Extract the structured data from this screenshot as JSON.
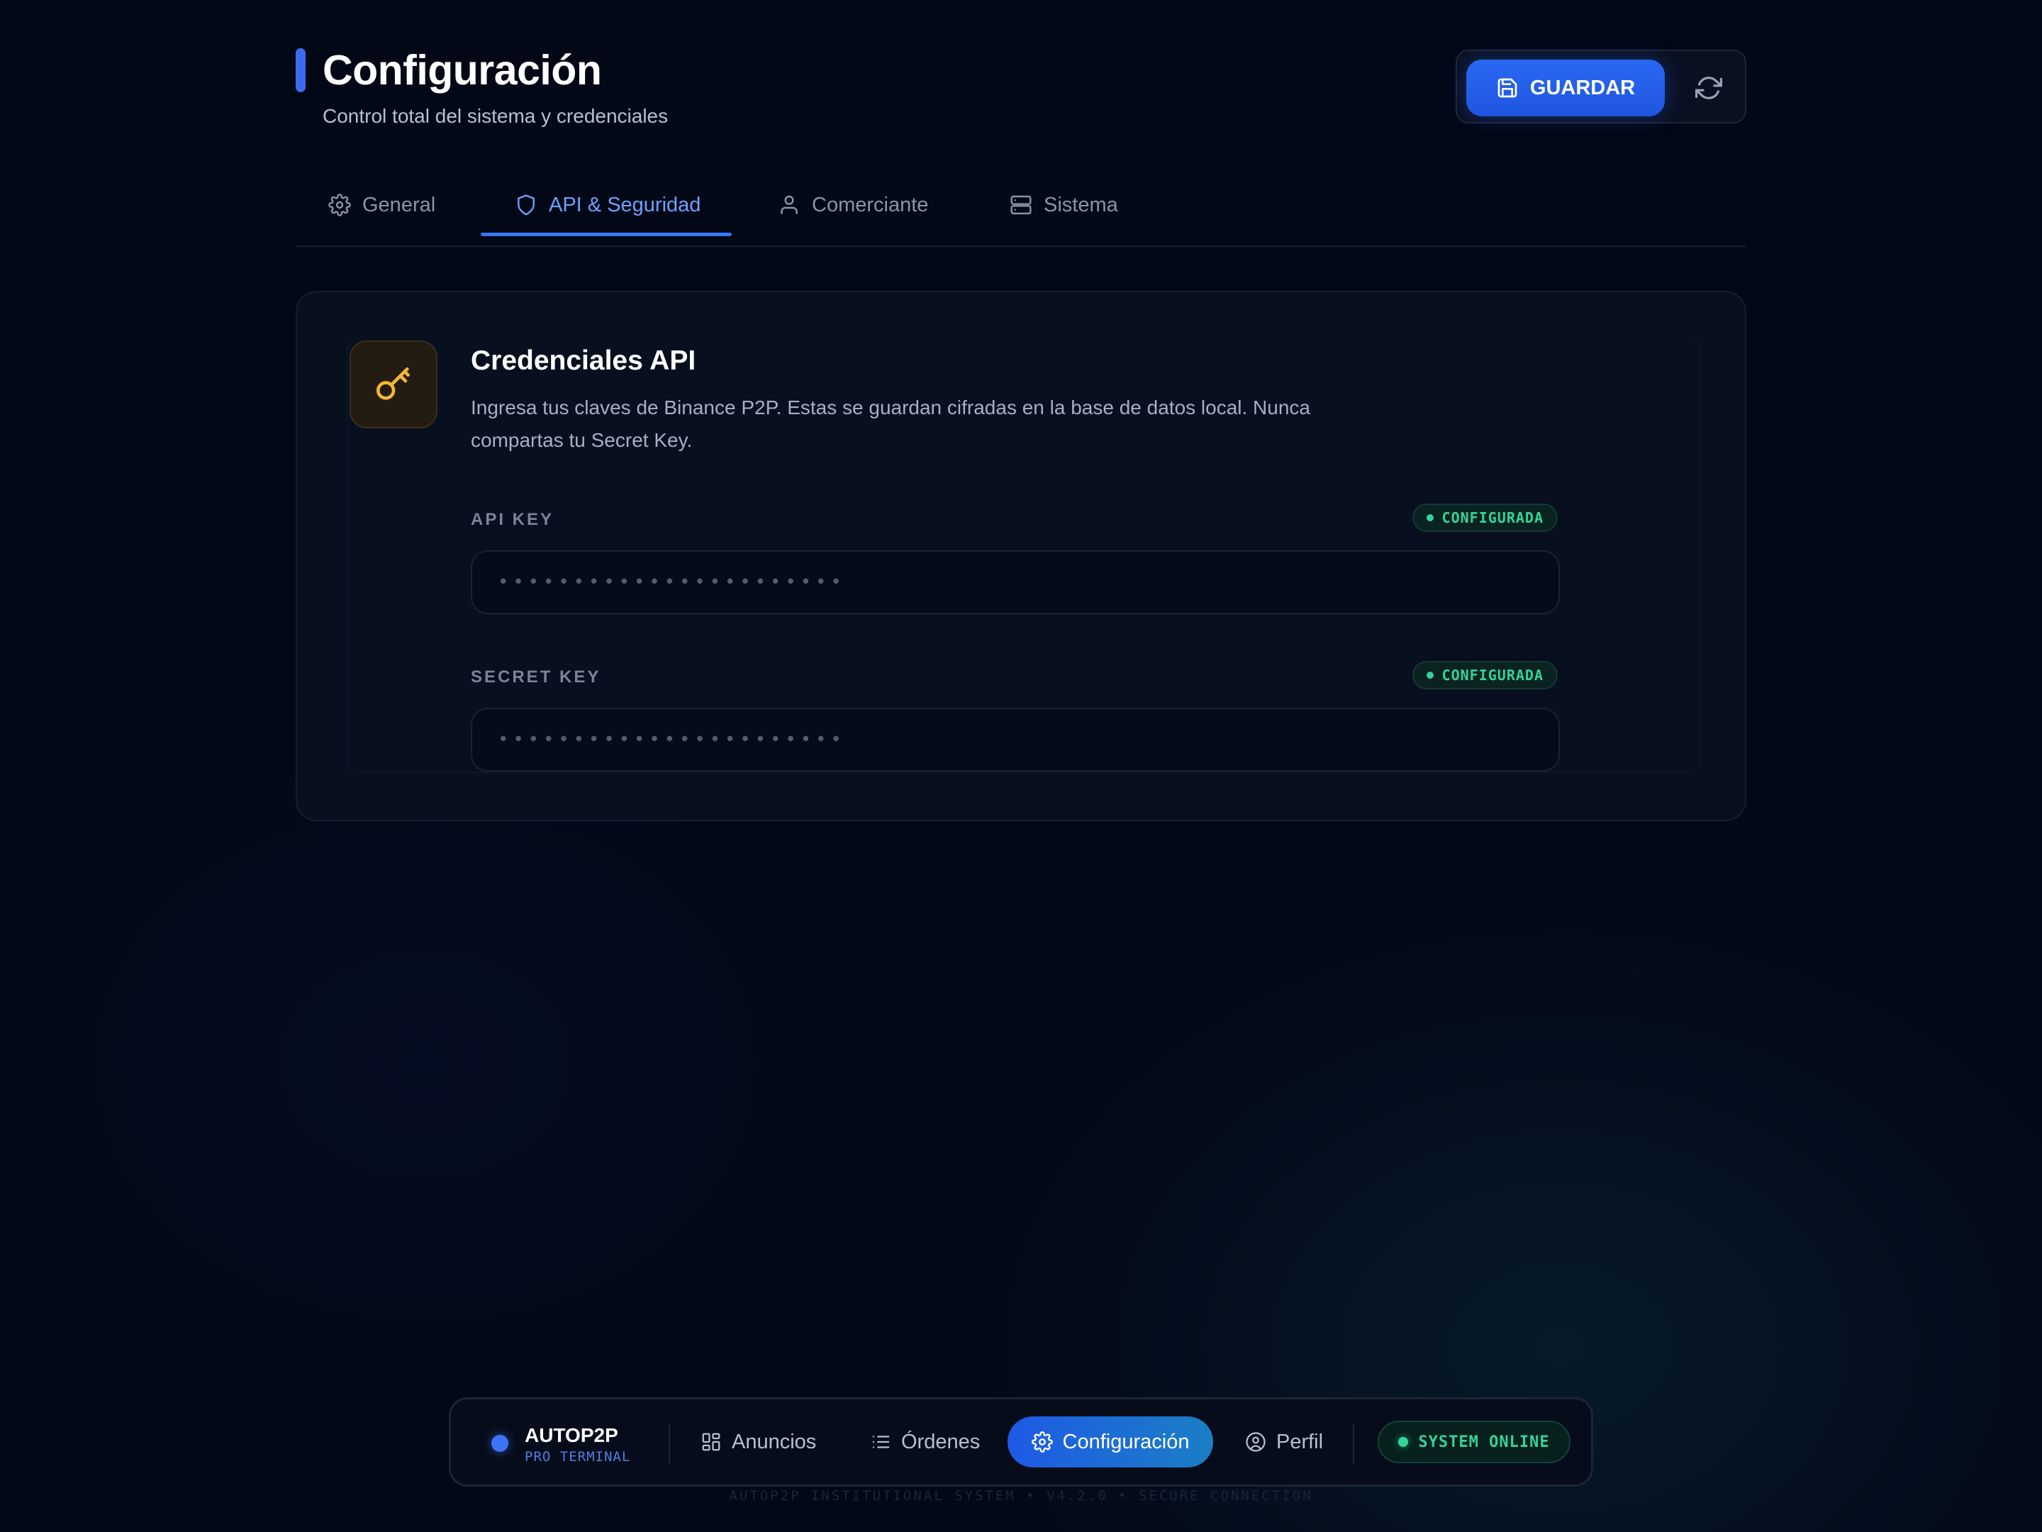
{
  "header": {
    "title": "Configuración",
    "subtitle": "Control total del sistema y credenciales",
    "save_label": "GUARDAR"
  },
  "tabs": [
    {
      "label": "General",
      "icon": "gear-icon",
      "active": false
    },
    {
      "label": "API & Seguridad",
      "icon": "shield-icon",
      "active": true
    },
    {
      "label": "Comerciante",
      "icon": "user-icon",
      "active": false
    },
    {
      "label": "Sistema",
      "icon": "server-icon",
      "active": false
    }
  ],
  "credentials": {
    "title": "Credenciales API",
    "description": "Ingresa tus claves de Binance P2P. Estas se guardan cifradas en la base de datos local. Nunca compartas tu Secret Key.",
    "fields": [
      {
        "label": "API KEY",
        "status": "CONFIGURADA",
        "value": "•••••••••••••••••••••••"
      },
      {
        "label": "SECRET KEY",
        "status": "CONFIGURADA",
        "value": "•••••••••••••••••••••••"
      }
    ]
  },
  "bottom_nav": {
    "brand_name": "AUTOP2P",
    "brand_sub": "PRO TERMINAL",
    "items": [
      {
        "label": "Anuncios",
        "icon": "grid-icon",
        "active": false
      },
      {
        "label": "Órdenes",
        "icon": "list-icon",
        "active": false
      },
      {
        "label": "Configuración",
        "icon": "gear-icon",
        "active": true
      },
      {
        "label": "Perfil",
        "icon": "user-circle-icon",
        "active": false
      }
    ],
    "status": "SYSTEM ONLINE"
  },
  "footer": "AUTOP2P INSTITUTIONAL SYSTEM • V4.2.0 • SECURE CONNECTION",
  "colors": {
    "accent": "#2a69f2",
    "success": "#34d399",
    "key_icon": "#f5b82e",
    "background": "#030817"
  }
}
